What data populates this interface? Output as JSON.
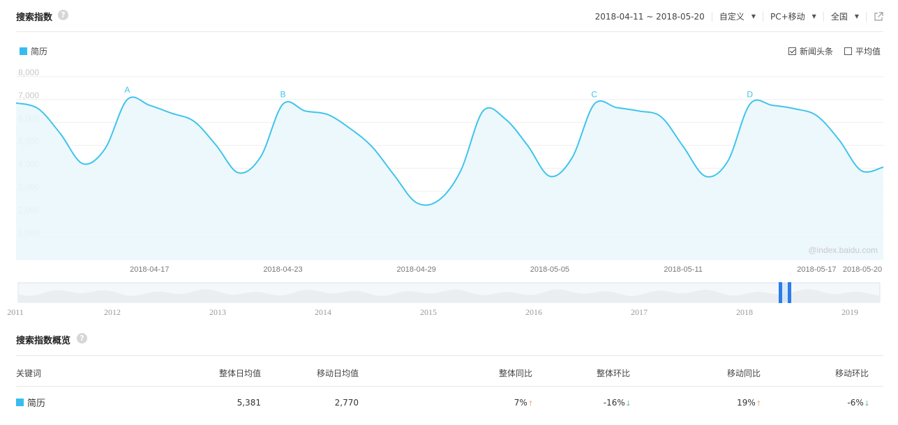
{
  "header": {
    "title": "搜索指数",
    "help": "?",
    "date_range": "2018-04-11 ~ 2018-05-20",
    "custom_label": "自定义",
    "device_label": "PC+移动",
    "region_label": "全国"
  },
  "legend": {
    "keyword": "简历",
    "color": "#36bdf0"
  },
  "options": {
    "news": "新闻头条",
    "news_checked": true,
    "avg": "平均值",
    "avg_checked": false
  },
  "watermark": "@index.baidu.com",
  "chart_data": {
    "type": "area",
    "title": "",
    "series": [
      {
        "name": "简历",
        "x": [
          "2018-04-11",
          "2018-04-12",
          "2018-04-13",
          "2018-04-14",
          "2018-04-15",
          "2018-04-16",
          "2018-04-17",
          "2018-04-18",
          "2018-04-19",
          "2018-04-20",
          "2018-04-21",
          "2018-04-22",
          "2018-04-23",
          "2018-04-24",
          "2018-04-25",
          "2018-04-26",
          "2018-04-27",
          "2018-04-28",
          "2018-04-29",
          "2018-04-30",
          "2018-05-01",
          "2018-05-02",
          "2018-05-03",
          "2018-05-04",
          "2018-05-05",
          "2018-05-06",
          "2018-05-07",
          "2018-05-08",
          "2018-05-09",
          "2018-05-10",
          "2018-05-11",
          "2018-05-12",
          "2018-05-13",
          "2018-05-14",
          "2018-05-15",
          "2018-05-16",
          "2018-05-17",
          "2018-05-18",
          "2018-05-19",
          "2018-05-20"
        ],
        "values": [
          6850,
          6600,
          5500,
          4200,
          4850,
          7000,
          6750,
          6400,
          6050,
          5000,
          3800,
          4500,
          6800,
          6500,
          6350,
          5750,
          4950,
          3700,
          2500,
          2600,
          3900,
          6500,
          6150,
          5000,
          3650,
          4450,
          6800,
          6650,
          6500,
          6250,
          4950,
          3650,
          4300,
          6800,
          6750,
          6600,
          6300,
          5250,
          3900,
          4050
        ]
      }
    ],
    "ylim": [
      0,
      8000
    ],
    "yticks": [
      "8,000",
      "7,000",
      "6,000",
      "5,000",
      "4,000",
      "3,000",
      "2,000",
      "1,000"
    ],
    "xticks": [
      {
        "label": "2018-04-17",
        "index": 6
      },
      {
        "label": "2018-04-23",
        "index": 12
      },
      {
        "label": "2018-04-29",
        "index": 18
      },
      {
        "label": "2018-05-05",
        "index": 24
      },
      {
        "label": "2018-05-11",
        "index": 30
      },
      {
        "label": "2018-05-17",
        "index": 36
      },
      {
        "label": "2018-05-20",
        "index": 39
      }
    ],
    "annotations": [
      {
        "label": "A",
        "index": 5
      },
      {
        "label": "B",
        "index": 12
      },
      {
        "label": "C",
        "index": 26
      },
      {
        "label": "D",
        "index": 33
      }
    ],
    "grid": true,
    "line_color": "#3fc4ec"
  },
  "brush": {
    "years": [
      "2011",
      "2012",
      "2013",
      "2014",
      "2015",
      "2016",
      "2017",
      "2018",
      "2019"
    ]
  },
  "overview": {
    "title": "搜索指数概览",
    "headers": {
      "keyword": "关键词",
      "overall_avg": "整体日均值",
      "mobile_avg": "移动日均值",
      "overall_yoy": "整体同比",
      "overall_mom": "整体环比",
      "mobile_yoy": "移动同比",
      "mobile_mom": "移动环比"
    },
    "row": {
      "keyword": "简历",
      "overall_avg": "5,381",
      "mobile_avg": "2,770",
      "overall_yoy": "7%",
      "overall_mom": "-16%",
      "mobile_yoy": "19%",
      "mobile_mom": "-6%"
    }
  }
}
